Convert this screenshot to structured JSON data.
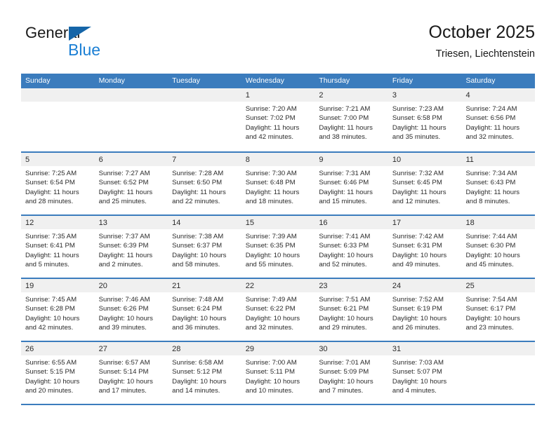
{
  "brand": {
    "name_part1": "General",
    "name_part2": "Blue",
    "triangle_color": "#1565a8",
    "blue_color": "#1b7fd4"
  },
  "header": {
    "title": "October 2025",
    "subtitle": "Triesen, Liechtenstein"
  },
  "theme": {
    "header_blue": "#3b7cbd",
    "date_band": "#f0f0f0",
    "text": "#2b2b2b"
  },
  "weekdays": [
    "Sunday",
    "Monday",
    "Tuesday",
    "Wednesday",
    "Thursday",
    "Friday",
    "Saturday"
  ],
  "weeks": [
    [
      {
        "empty": true
      },
      {
        "empty": true
      },
      {
        "empty": true
      },
      {
        "day": "1",
        "sunrise": "Sunrise: 7:20 AM",
        "sunset": "Sunset: 7:02 PM",
        "daylight_1": "Daylight: 11 hours",
        "daylight_2": "and 42 minutes."
      },
      {
        "day": "2",
        "sunrise": "Sunrise: 7:21 AM",
        "sunset": "Sunset: 7:00 PM",
        "daylight_1": "Daylight: 11 hours",
        "daylight_2": "and 38 minutes."
      },
      {
        "day": "3",
        "sunrise": "Sunrise: 7:23 AM",
        "sunset": "Sunset: 6:58 PM",
        "daylight_1": "Daylight: 11 hours",
        "daylight_2": "and 35 minutes."
      },
      {
        "day": "4",
        "sunrise": "Sunrise: 7:24 AM",
        "sunset": "Sunset: 6:56 PM",
        "daylight_1": "Daylight: 11 hours",
        "daylight_2": "and 32 minutes."
      }
    ],
    [
      {
        "day": "5",
        "sunrise": "Sunrise: 7:25 AM",
        "sunset": "Sunset: 6:54 PM",
        "daylight_1": "Daylight: 11 hours",
        "daylight_2": "and 28 minutes."
      },
      {
        "day": "6",
        "sunrise": "Sunrise: 7:27 AM",
        "sunset": "Sunset: 6:52 PM",
        "daylight_1": "Daylight: 11 hours",
        "daylight_2": "and 25 minutes."
      },
      {
        "day": "7",
        "sunrise": "Sunrise: 7:28 AM",
        "sunset": "Sunset: 6:50 PM",
        "daylight_1": "Daylight: 11 hours",
        "daylight_2": "and 22 minutes."
      },
      {
        "day": "8",
        "sunrise": "Sunrise: 7:30 AM",
        "sunset": "Sunset: 6:48 PM",
        "daylight_1": "Daylight: 11 hours",
        "daylight_2": "and 18 minutes."
      },
      {
        "day": "9",
        "sunrise": "Sunrise: 7:31 AM",
        "sunset": "Sunset: 6:46 PM",
        "daylight_1": "Daylight: 11 hours",
        "daylight_2": "and 15 minutes."
      },
      {
        "day": "10",
        "sunrise": "Sunrise: 7:32 AM",
        "sunset": "Sunset: 6:45 PM",
        "daylight_1": "Daylight: 11 hours",
        "daylight_2": "and 12 minutes."
      },
      {
        "day": "11",
        "sunrise": "Sunrise: 7:34 AM",
        "sunset": "Sunset: 6:43 PM",
        "daylight_1": "Daylight: 11 hours",
        "daylight_2": "and 8 minutes."
      }
    ],
    [
      {
        "day": "12",
        "sunrise": "Sunrise: 7:35 AM",
        "sunset": "Sunset: 6:41 PM",
        "daylight_1": "Daylight: 11 hours",
        "daylight_2": "and 5 minutes."
      },
      {
        "day": "13",
        "sunrise": "Sunrise: 7:37 AM",
        "sunset": "Sunset: 6:39 PM",
        "daylight_1": "Daylight: 11 hours",
        "daylight_2": "and 2 minutes."
      },
      {
        "day": "14",
        "sunrise": "Sunrise: 7:38 AM",
        "sunset": "Sunset: 6:37 PM",
        "daylight_1": "Daylight: 10 hours",
        "daylight_2": "and 58 minutes."
      },
      {
        "day": "15",
        "sunrise": "Sunrise: 7:39 AM",
        "sunset": "Sunset: 6:35 PM",
        "daylight_1": "Daylight: 10 hours",
        "daylight_2": "and 55 minutes."
      },
      {
        "day": "16",
        "sunrise": "Sunrise: 7:41 AM",
        "sunset": "Sunset: 6:33 PM",
        "daylight_1": "Daylight: 10 hours",
        "daylight_2": "and 52 minutes."
      },
      {
        "day": "17",
        "sunrise": "Sunrise: 7:42 AM",
        "sunset": "Sunset: 6:31 PM",
        "daylight_1": "Daylight: 10 hours",
        "daylight_2": "and 49 minutes."
      },
      {
        "day": "18",
        "sunrise": "Sunrise: 7:44 AM",
        "sunset": "Sunset: 6:30 PM",
        "daylight_1": "Daylight: 10 hours",
        "daylight_2": "and 45 minutes."
      }
    ],
    [
      {
        "day": "19",
        "sunrise": "Sunrise: 7:45 AM",
        "sunset": "Sunset: 6:28 PM",
        "daylight_1": "Daylight: 10 hours",
        "daylight_2": "and 42 minutes."
      },
      {
        "day": "20",
        "sunrise": "Sunrise: 7:46 AM",
        "sunset": "Sunset: 6:26 PM",
        "daylight_1": "Daylight: 10 hours",
        "daylight_2": "and 39 minutes."
      },
      {
        "day": "21",
        "sunrise": "Sunrise: 7:48 AM",
        "sunset": "Sunset: 6:24 PM",
        "daylight_1": "Daylight: 10 hours",
        "daylight_2": "and 36 minutes."
      },
      {
        "day": "22",
        "sunrise": "Sunrise: 7:49 AM",
        "sunset": "Sunset: 6:22 PM",
        "daylight_1": "Daylight: 10 hours",
        "daylight_2": "and 32 minutes."
      },
      {
        "day": "23",
        "sunrise": "Sunrise: 7:51 AM",
        "sunset": "Sunset: 6:21 PM",
        "daylight_1": "Daylight: 10 hours",
        "daylight_2": "and 29 minutes."
      },
      {
        "day": "24",
        "sunrise": "Sunrise: 7:52 AM",
        "sunset": "Sunset: 6:19 PM",
        "daylight_1": "Daylight: 10 hours",
        "daylight_2": "and 26 minutes."
      },
      {
        "day": "25",
        "sunrise": "Sunrise: 7:54 AM",
        "sunset": "Sunset: 6:17 PM",
        "daylight_1": "Daylight: 10 hours",
        "daylight_2": "and 23 minutes."
      }
    ],
    [
      {
        "day": "26",
        "sunrise": "Sunrise: 6:55 AM",
        "sunset": "Sunset: 5:15 PM",
        "daylight_1": "Daylight: 10 hours",
        "daylight_2": "and 20 minutes."
      },
      {
        "day": "27",
        "sunrise": "Sunrise: 6:57 AM",
        "sunset": "Sunset: 5:14 PM",
        "daylight_1": "Daylight: 10 hours",
        "daylight_2": "and 17 minutes."
      },
      {
        "day": "28",
        "sunrise": "Sunrise: 6:58 AM",
        "sunset": "Sunset: 5:12 PM",
        "daylight_1": "Daylight: 10 hours",
        "daylight_2": "and 14 minutes."
      },
      {
        "day": "29",
        "sunrise": "Sunrise: 7:00 AM",
        "sunset": "Sunset: 5:11 PM",
        "daylight_1": "Daylight: 10 hours",
        "daylight_2": "and 10 minutes."
      },
      {
        "day": "30",
        "sunrise": "Sunrise: 7:01 AM",
        "sunset": "Sunset: 5:09 PM",
        "daylight_1": "Daylight: 10 hours",
        "daylight_2": "and 7 minutes."
      },
      {
        "day": "31",
        "sunrise": "Sunrise: 7:03 AM",
        "sunset": "Sunset: 5:07 PM",
        "daylight_1": "Daylight: 10 hours",
        "daylight_2": "and 4 minutes."
      },
      {
        "empty": true
      }
    ]
  ]
}
